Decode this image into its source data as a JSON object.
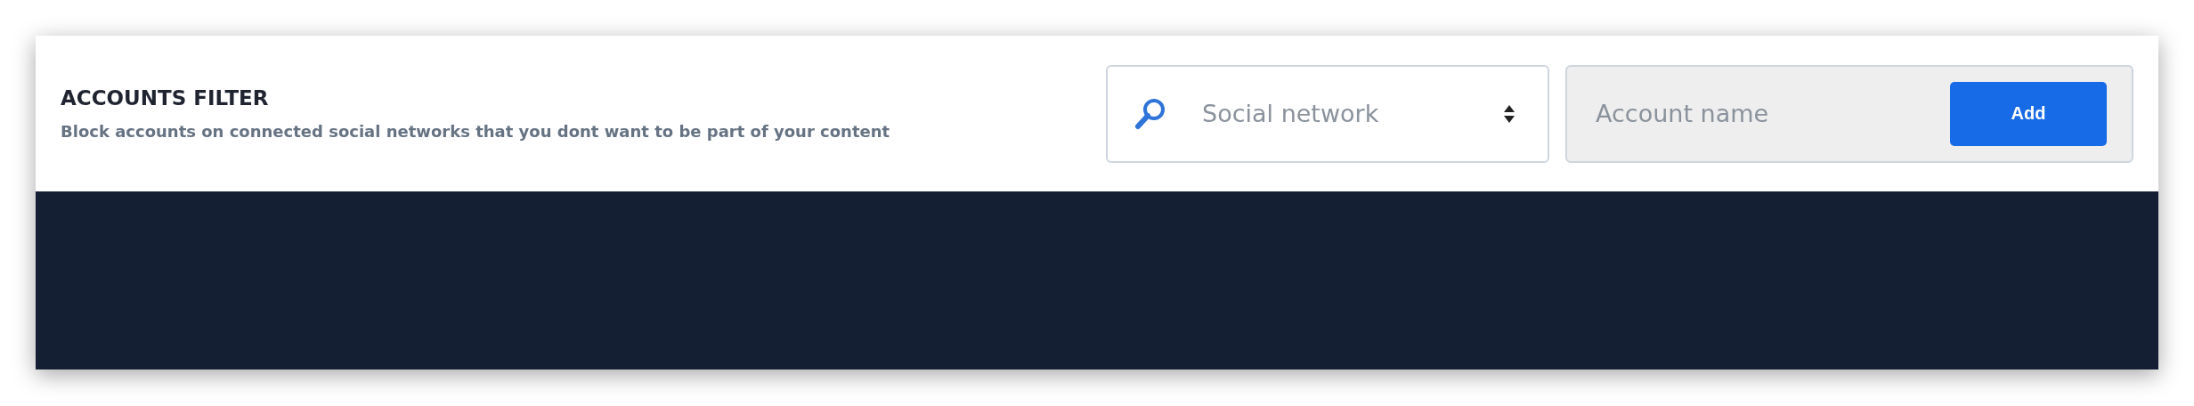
{
  "header": {
    "title": "ACCOUNTS FILTER",
    "description": "Block accounts on connected social networks that you dont want to be part of your content"
  },
  "network_select": {
    "placeholder": "Social network"
  },
  "account_field": {
    "placeholder": "Account name"
  },
  "add_button": {
    "label": "Add"
  }
}
